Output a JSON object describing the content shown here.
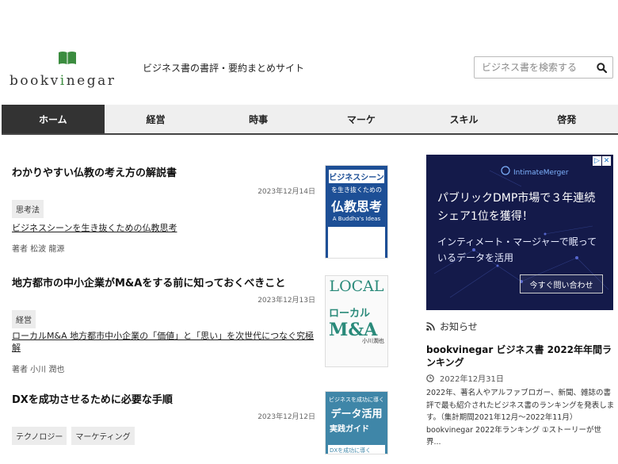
{
  "site": {
    "logo_text_a": "bookv",
    "logo_text_b": "i",
    "logo_text_c": "negar",
    "tagline": "ビジネス書の書評・要約まとめサイト",
    "brand_color": "#3b8c3f"
  },
  "search": {
    "placeholder": "ビジネス書を検索する",
    "icon": "search-icon"
  },
  "nav": {
    "tabs": [
      {
        "label": "ホーム",
        "active": true
      },
      {
        "label": "経営",
        "active": false
      },
      {
        "label": "時事",
        "active": false
      },
      {
        "label": "マーケ",
        "active": false
      },
      {
        "label": "スキル",
        "active": false
      },
      {
        "label": "啓発",
        "active": false
      }
    ]
  },
  "articles": [
    {
      "title": "わかりやすい仏教の考え方の解説書",
      "date": "2023年12月14日",
      "tags": [
        "思考法"
      ],
      "book": "ビジネスシーンを生き抜くための仏教思考",
      "author": "著者 松波 龍源",
      "cover": {
        "line1": "ビジネスシーン",
        "line2": "を生き抜くための",
        "line3": "仏教思考",
        "line4": "A Buddha's Ideas",
        "color": "#1d4f96"
      }
    },
    {
      "title": "地方都市の中小企業がM&Aをする前に知っておくべきこと",
      "date": "2023年12月13日",
      "tags": [
        "経営"
      ],
      "book": "ローカルM&A 地方都市中小企業の「価値」と「思い」を次世代につなぐ究極解",
      "author": "著者 小川 潤也",
      "cover": {
        "line1": "LOCAL",
        "line2": "ローカル",
        "line3": "M&A",
        "line4": "小川潤也",
        "color": "#2a8a7a"
      }
    },
    {
      "title": "DXを成功させるために必要な手順",
      "date": "2023年12月12日",
      "tags": [
        "テクノロジー",
        "マーケティング"
      ],
      "cover": {
        "line1": "ビジネスを成功に導く",
        "line2": "データ活用",
        "line3": "実践ガイド",
        "line4": "DXを成功に導く",
        "color": "#3f86a8"
      }
    }
  ],
  "ad": {
    "brand": "IntimateMerger",
    "headline": "パブリックDMP市場で３年連続シェア1位を獲得！",
    "sub": "インティメート・マージャーで眠っているデータを活用",
    "cta": "今すぐ問い合わせ"
  },
  "news": {
    "heading": "お知らせ",
    "title": "bookvinegar ビジネス書 2022年年間ランキング",
    "date": "2022年12月31日",
    "body": "2022年、著名人やアルファブロガー、新聞、雑誌の書評で最も紹介されたビジネス書のランキングを発表します。（集計期間2021年12月～2022年11月） bookvinegar 2022年ランキング ①ストーリーが世界..."
  }
}
